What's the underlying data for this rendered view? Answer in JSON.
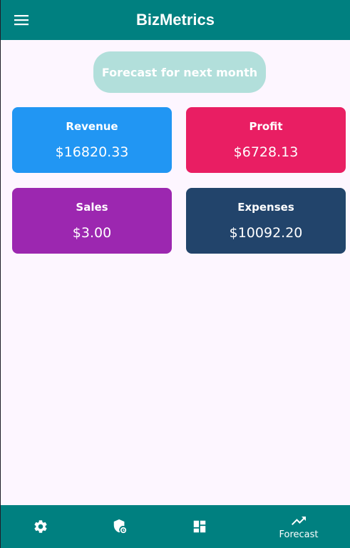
{
  "app": {
    "title": "BizMetrics",
    "menu_icon": "menu-icon"
  },
  "colors": {
    "primary": "#008080",
    "background": "#fdf6ff",
    "forecast_button": "#b2dfdb",
    "revenue": "#2196f3",
    "profit": "#e91e63",
    "sales": "#9c27b0",
    "expenses": "#22446b"
  },
  "forecast_button": {
    "label": "Forecast for next month"
  },
  "cards": {
    "revenue": {
      "label": "Revenue",
      "value": "$16820.33"
    },
    "profit": {
      "label": "Profit",
      "value": "$6728.13"
    },
    "sales": {
      "label": "Sales",
      "value": "$3.00"
    },
    "expenses": {
      "label": "Expenses",
      "value": "$10092.20"
    }
  },
  "bottom_nav": {
    "items": [
      {
        "icon": "settings-icon",
        "label": ""
      },
      {
        "icon": "security-badge-icon",
        "label": ""
      },
      {
        "icon": "dashboard-icon",
        "label": ""
      },
      {
        "icon": "trending-up-icon",
        "label": "Forecast"
      }
    ]
  }
}
